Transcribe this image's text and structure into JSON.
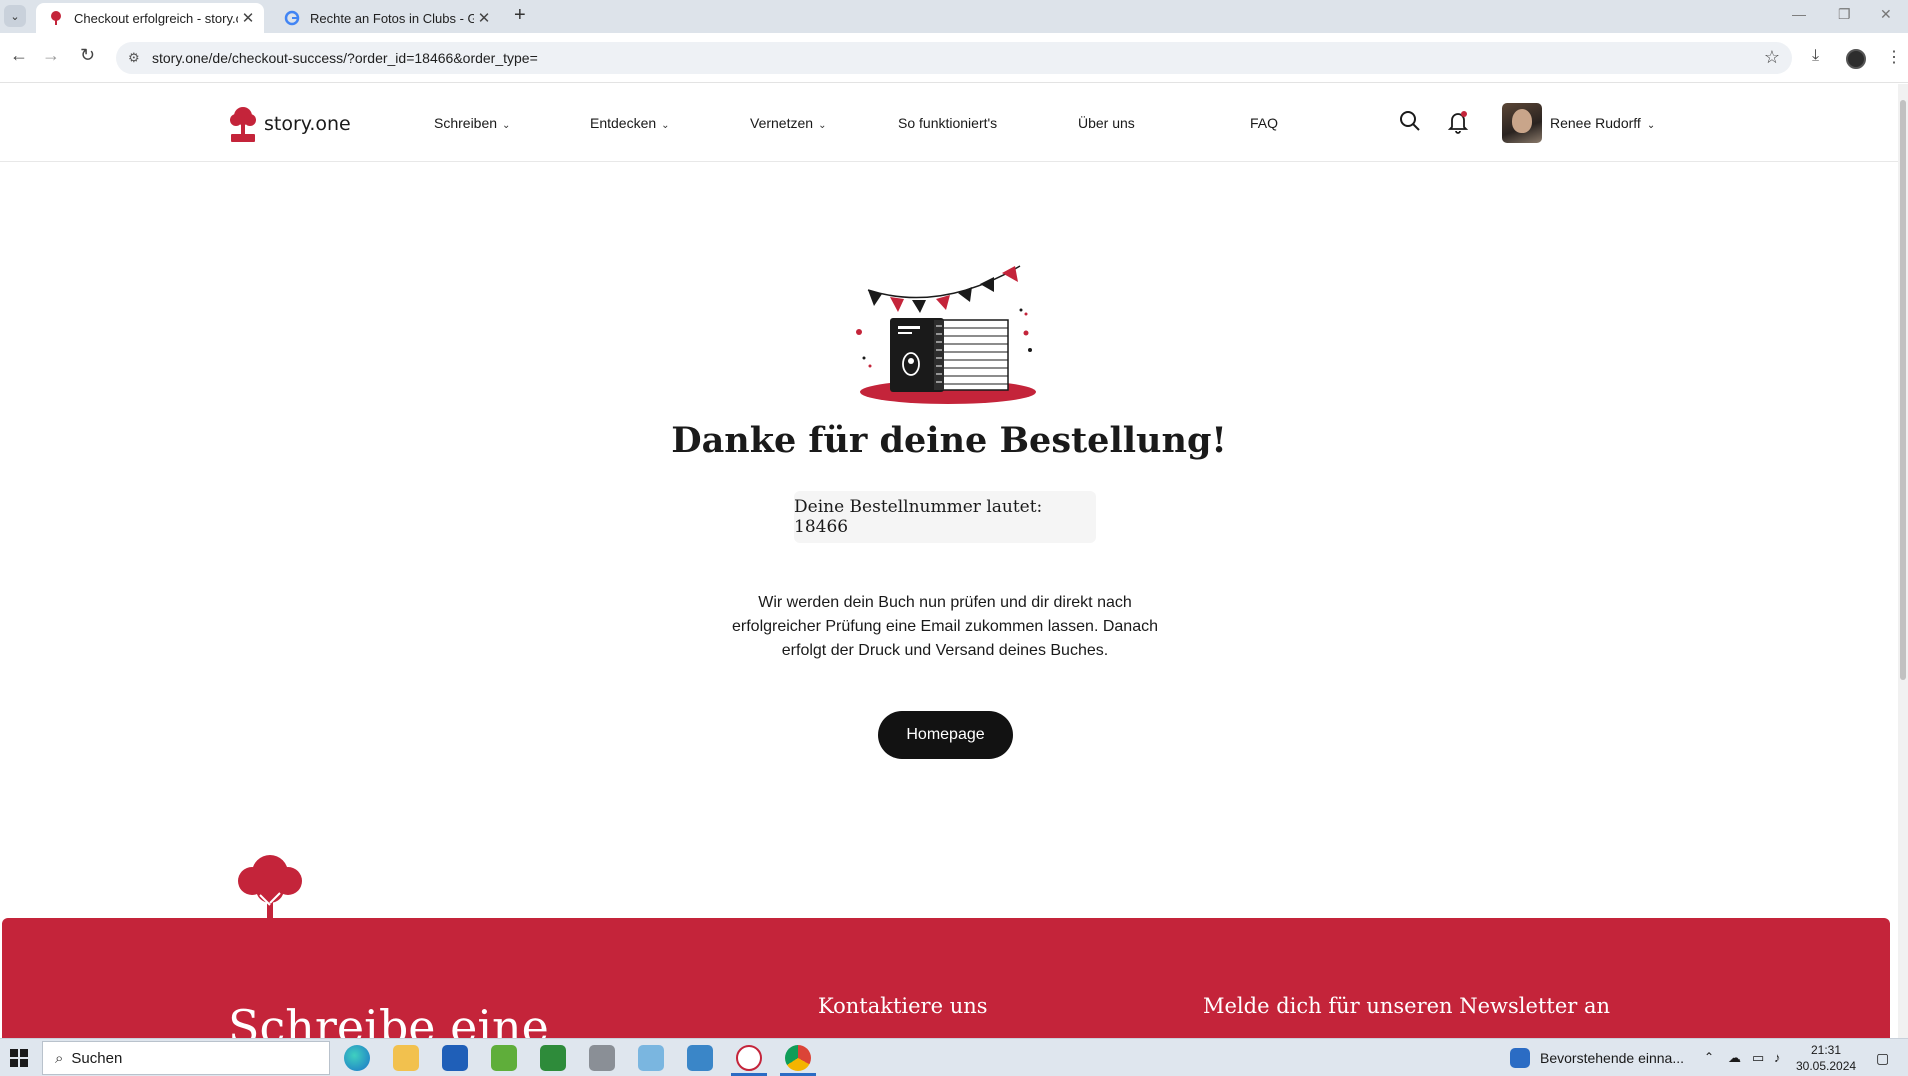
{
  "browser": {
    "tabs": [
      {
        "title": "Checkout erfolgreich - story.one",
        "active": true
      },
      {
        "title": "Rechte an Fotos in Clubs - Google",
        "active": false
      }
    ],
    "new_tab": "+",
    "url": "story.one/de/checkout-success/?order_id=18466&order_type="
  },
  "site": {
    "logo_text": "story.one",
    "nav": [
      {
        "label": "Schreiben",
        "dropdown": true
      },
      {
        "label": "Entdecken",
        "dropdown": true
      },
      {
        "label": "Vernetzen",
        "dropdown": true
      },
      {
        "label": "So funktioniert's",
        "dropdown": false
      },
      {
        "label": "Über uns",
        "dropdown": false
      },
      {
        "label": "FAQ",
        "dropdown": false
      }
    ],
    "user_name": "Renee Rudorff",
    "brand_color": "#c4243a"
  },
  "main": {
    "title": "Danke für deine Bestellung!",
    "order_number_text": "Deine Bestellnummer lautet: 18466",
    "message": "Wir werden dein Buch nun prüfen und dir direkt nach erfolgreicher Prüfung eine Email zukommen lassen. Danach erfolgt der Druck und Versand deines Buches.",
    "homepage_button": "Homepage"
  },
  "footer": {
    "headline": "Schreibe eine",
    "contact_heading": "Kontaktiere uns",
    "newsletter_heading": "Melde dich für unseren Newsletter an"
  },
  "taskbar": {
    "search_placeholder": "Suchen",
    "notification_text": "Bevorstehende einna...",
    "time": "21:31",
    "date": "30.05.2024"
  }
}
